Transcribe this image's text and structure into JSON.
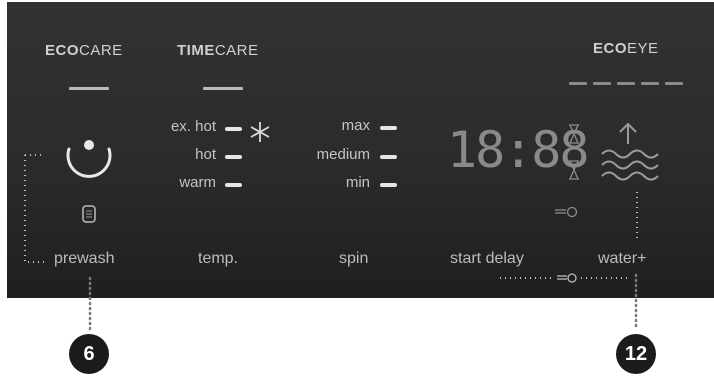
{
  "programs": {
    "ecocare": {
      "bold": "ECO",
      "normal": "CARE"
    },
    "timecare": {
      "bold": "TIME",
      "normal": "CARE"
    },
    "ecoeye": {
      "bold": "ECO",
      "normal": "EYE"
    }
  },
  "temp": {
    "options": [
      "ex. hot",
      "hot",
      "warm"
    ],
    "label": "temp."
  },
  "spin": {
    "options": [
      "max",
      "medium",
      "min"
    ],
    "label": "spin"
  },
  "prewash": {
    "label": "prewash"
  },
  "start_delay": {
    "label": "start delay",
    "display": "18:88"
  },
  "water": {
    "label": "water+"
  },
  "callouts": {
    "left": "6",
    "right": "12"
  },
  "colors": {
    "panel": "#2e2e2e",
    "text": "#c4c4c4",
    "callout": "#1b1b1b"
  }
}
